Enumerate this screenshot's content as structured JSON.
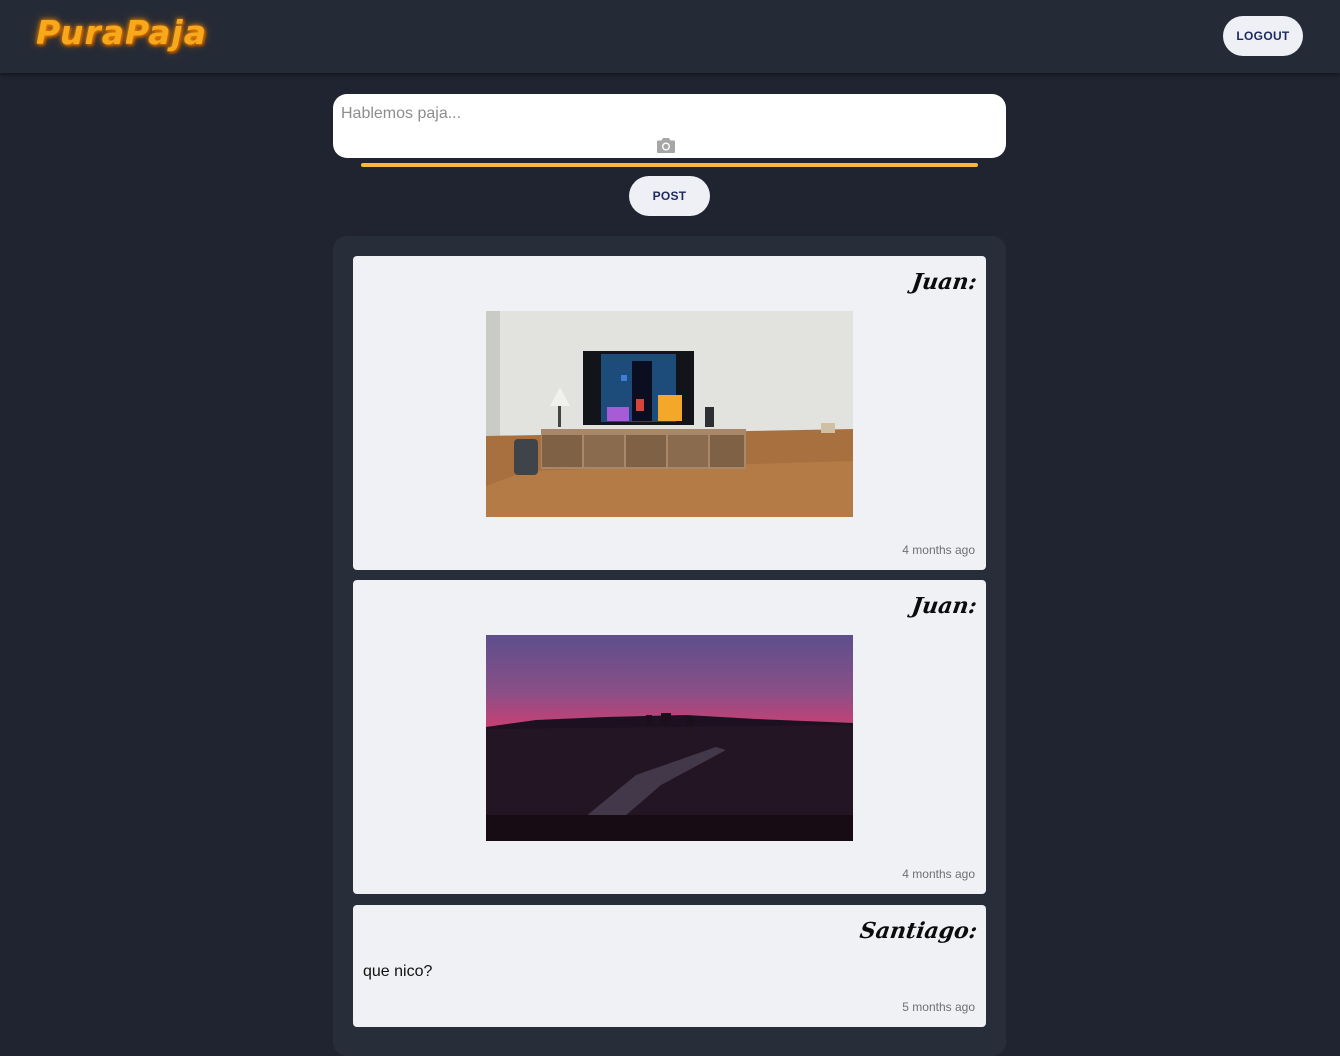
{
  "app": {
    "logo_text": "PuraPaja",
    "brand_color": "#f7a81b"
  },
  "header": {
    "logout_label": "LOGOUT"
  },
  "composer": {
    "placeholder": "Hablemos paja...",
    "value": "",
    "camera_icon": "camera-icon",
    "post_label": "POST",
    "accent_color": "#f6b93b"
  },
  "posts": [
    {
      "author": "Juan:",
      "text": "",
      "image": "living room with a TV on a wooden stand showing a Tetris game",
      "time": "4 months ago"
    },
    {
      "author": "Juan:",
      "text": "",
      "image": "sunset over a city skyline with a highway",
      "time": "4 months ago"
    },
    {
      "author": "Santiago:",
      "text": "que nico?",
      "time": "5 months ago"
    }
  ]
}
